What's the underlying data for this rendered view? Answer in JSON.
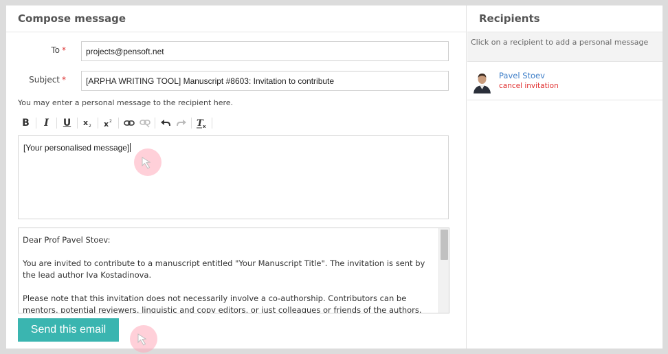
{
  "compose": {
    "title": "Compose message",
    "to_label": "To",
    "to_value": "projects@pensoft.net",
    "subject_label": "Subject",
    "subject_value": "[ARPHA WRITING TOOL] Manuscript #8603: Invitation to contribute",
    "required_mark": "*",
    "hint": "You may enter a personal message to the recipient here.",
    "toolbar": {
      "bold": "B",
      "italic": "I",
      "underline": "U",
      "subscript_icon": "subscript-icon",
      "superscript_icon": "superscript-icon",
      "link_icon": "link-icon",
      "unlink_icon": "unlink-icon",
      "undo_icon": "undo-icon",
      "redo_icon": "redo-icon",
      "remove_format_icon": "remove-format-icon"
    },
    "editor_text": "[Your personalised message]",
    "template": {
      "greeting": "Dear Prof Pavel Stoev:",
      "paragraph1": "You are invited to contribute to a manuscript entitled \"Your Manuscript Title\". The invitation is sent by the lead author Iva Kostadinova.",
      "paragraph2": "Please note that this invitation does not necessarily involve a co-authorship. Contributors can be mentors, potential reviewers, linguistic and copy editors, or just colleagues or friends of the authors."
    },
    "send_label": "Send this email"
  },
  "recipients": {
    "title": "Recipients",
    "hint": "Click on a recipient to add a personal message",
    "items": [
      {
        "name": "Pavel Stoev",
        "action": "cancel invitation"
      }
    ]
  },
  "colors": {
    "accent": "#3ab5b0",
    "link": "#3a7cc7",
    "danger": "#e03030",
    "required": "#dd3333"
  }
}
